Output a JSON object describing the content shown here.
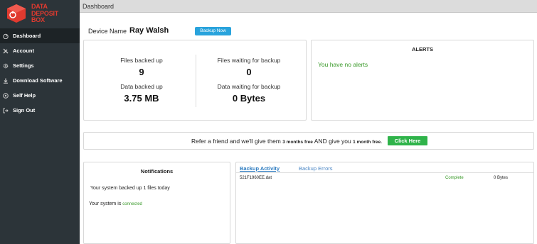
{
  "brand": {
    "name_line1": "DATA",
    "name_line2": "DEPOSIT",
    "name_line3": "BOX",
    "color": "#e03a2f"
  },
  "sidebar": {
    "items": [
      {
        "label": "Dashboard",
        "icon": "dashboard-icon",
        "active": true
      },
      {
        "label": "Account",
        "icon": "wrench-icon"
      },
      {
        "label": "Settings",
        "icon": "gear-icon"
      },
      {
        "label": "Download Software",
        "icon": "download-icon"
      },
      {
        "label": "Self Help",
        "icon": "help-icon"
      },
      {
        "label": "Sign Out",
        "icon": "sign-out-icon"
      }
    ]
  },
  "header": {
    "title": "Dashboard"
  },
  "device": {
    "label": "Device Name",
    "name": "Ray Walsh",
    "backup_button": "Backup Now"
  },
  "stats": {
    "files_backed_up_label": "Files backed up",
    "files_backed_up_value": "9",
    "files_waiting_label": "Files waiting for backup",
    "files_waiting_value": "0",
    "data_backed_up_label": "Data backed up",
    "data_backed_up_value": "3.75 MB",
    "data_waiting_label": "Data waiting for backup",
    "data_waiting_value": "0 Bytes"
  },
  "alerts": {
    "title": "ALERTS",
    "message": "You have no alerts"
  },
  "refer": {
    "text_part1": "Refer a friend and we'll give them ",
    "bold1": "3 months free",
    "text_part2": " AND give you ",
    "bold2": "1 month free.",
    "button": "Click Here"
  },
  "notifications": {
    "title": "Notifications",
    "line1": "Your system backed up 1 files today",
    "line2_prefix": "Your system is ",
    "line2_status": "connected"
  },
  "activity": {
    "tabs": [
      {
        "label": "Backup Activity",
        "active": true
      },
      {
        "label": "Backup Errors"
      }
    ],
    "rows": [
      {
        "file": "521F1960EE.dat",
        "status": "Complete",
        "size": "0 Bytes"
      }
    ]
  },
  "colors": {
    "sidebar": "#2c3439",
    "accent_blue": "#29a3dc",
    "success_green": "#2fb34a",
    "status_green": "#3a9a2a"
  }
}
